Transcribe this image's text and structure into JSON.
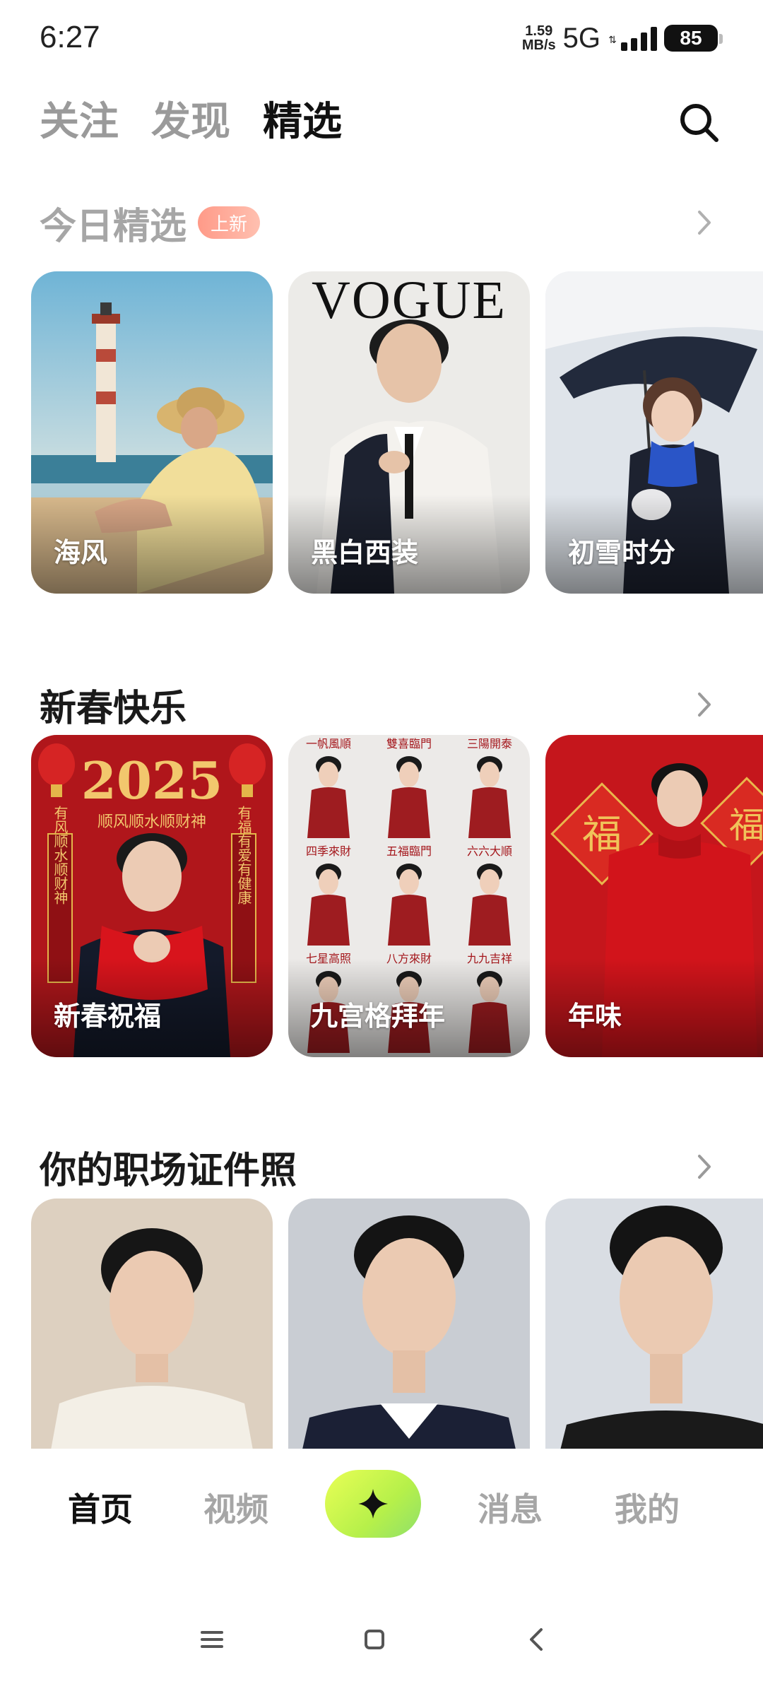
{
  "status_bar": {
    "time": "6:27",
    "net_speed_value": "1.59",
    "net_speed_unit": "MB/s",
    "network": "5G",
    "battery": "85"
  },
  "top_tabs": [
    {
      "label": "关注",
      "active": false
    },
    {
      "label": "发现",
      "active": false
    },
    {
      "label": "精选",
      "active": true
    }
  ],
  "sections": [
    {
      "title": "今日精选",
      "badge": "上新",
      "cards": [
        {
          "label": "海风"
        },
        {
          "label": "黑白西装"
        },
        {
          "label": "初雪时分"
        }
      ]
    },
    {
      "title": "新春快乐",
      "cards": [
        {
          "label": "新春祝福"
        },
        {
          "label": "九宫格拜年"
        },
        {
          "label": "年味"
        }
      ]
    },
    {
      "title": "你的职场证件照",
      "cards": [
        {
          "label": ""
        },
        {
          "label": ""
        },
        {
          "label": ""
        }
      ]
    }
  ],
  "card_art": {
    "vogue_text": "VOGUE",
    "year_text": "2025",
    "blessing_text": "顺风顺水顺财神",
    "couplet_left": "有风顺水顺财神",
    "couplet_right": "有福有爱有健康",
    "fu_char": "福",
    "grid_captions": [
      "一帆風順",
      "雙喜臨門",
      "三陽開泰",
      "四季來財",
      "五福臨門",
      "六六大順",
      "七星高照",
      "八方來財",
      "九九吉祥"
    ]
  },
  "bottom_nav": {
    "items": [
      {
        "label": "首页",
        "active": true
      },
      {
        "label": "视频",
        "active": false
      },
      {
        "label": "消息",
        "active": false
      },
      {
        "label": "我的",
        "active": false
      }
    ]
  },
  "colors": {
    "accent_green": "#c8f55a",
    "badge_red": "#ff9a88",
    "inactive_gray": "#a6a6a6"
  }
}
